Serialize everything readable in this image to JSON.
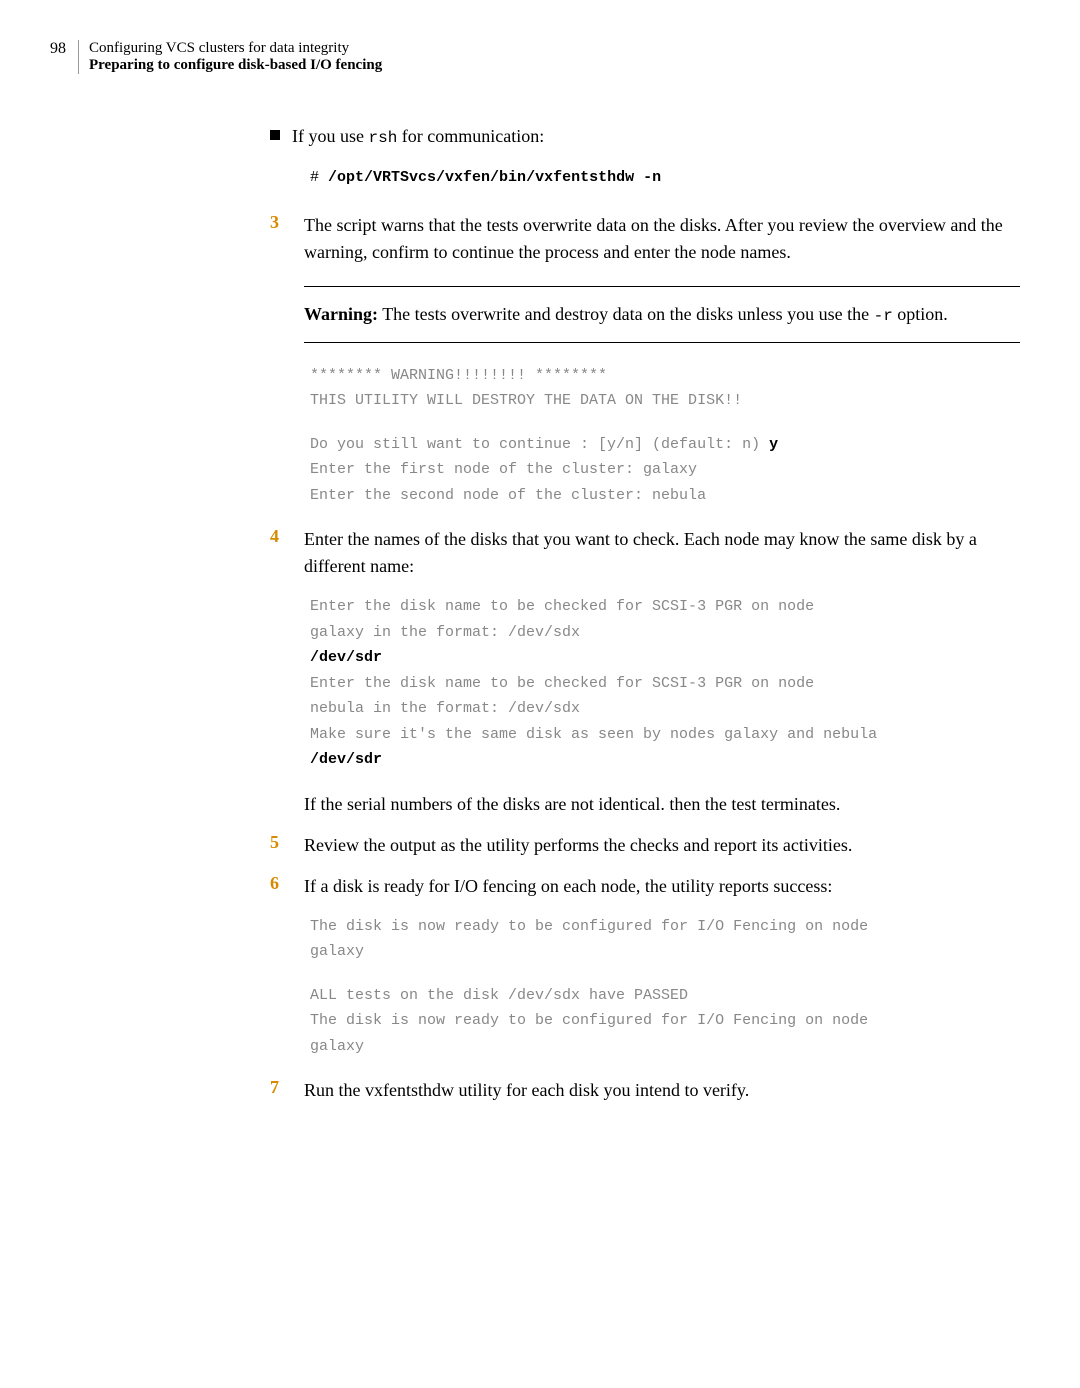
{
  "header": {
    "page_num": "98",
    "chapter": "Configuring VCS clusters for data integrity",
    "section": "Preparing to configure disk-based I/O fencing"
  },
  "bullet": {
    "text_before": "If you use ",
    "code": "rsh",
    "text_after": " for communication:"
  },
  "code1": {
    "hash": "#",
    "cmd": "/opt/VRTSvcs/vxfen/bin/vxfentsthdw -n"
  },
  "step3": {
    "num": "3",
    "text": "The script warns that the tests overwrite data on the disks. After you review the overview and the warning, confirm to continue the process and enter the node names."
  },
  "warning": {
    "label": "Warning:",
    "text_before": " The tests overwrite and destroy data on the disks unless you use the ",
    "code": "-r",
    "text_after": " option."
  },
  "code3a": "******** WARNING!!!!!!!! ********\nTHIS UTILITY WILL DESTROY THE DATA ON THE DISK!!",
  "code3b_line1": "Do you still want to continue : [y/n] (default: n) ",
  "code3b_bold": "y",
  "code3b_rest": "Enter the first node of the cluster: galaxy\nEnter the second node of the cluster: nebula",
  "step4": {
    "num": "4",
    "text": "Enter the names of the disks that you want to check. Each node may know the same disk by a different name:"
  },
  "code4a": "Enter the disk name to be checked for SCSI-3 PGR on node\ngalaxy in the format: /dev/sdx",
  "code4_bold1": "/dev/sdr",
  "code4b": "Enter the disk name to be checked for SCSI-3 PGR on node\nnebula in the format: /dev/sdx\nMake sure it's the same disk as seen by nodes galaxy and nebula",
  "code4_bold2": "/dev/sdr",
  "step4_note": "If the serial numbers of the disks are not identical. then the test terminates.",
  "step5": {
    "num": "5",
    "text": "Review the output as the utility performs the checks and report its activities."
  },
  "step6": {
    "num": "6",
    "text": "If a disk is ready for I/O fencing on each node, the utility reports success:"
  },
  "code6a": "The disk is now ready to be configured for I/O Fencing on node\ngalaxy",
  "code6b": "ALL tests on the disk /dev/sdx have PASSED\nThe disk is now ready to be configured for I/O Fencing on node\ngalaxy",
  "step7": {
    "num": "7",
    "text": "Run the vxfentsthdw utility for each disk you intend to verify."
  }
}
